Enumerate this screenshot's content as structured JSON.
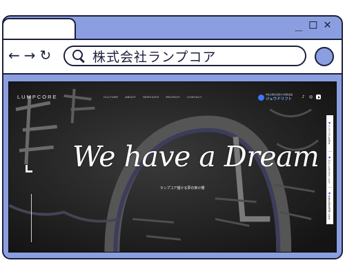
{
  "browser": {
    "window_controls": [
      "_",
      "□",
      "✕"
    ],
    "nav": {
      "back": "←",
      "forward": "→",
      "reload": "↻"
    },
    "url_text": "株式会社ランプコア",
    "colors": {
      "frame": "#8b9fe0",
      "outline": "#1b1f3b"
    }
  },
  "site": {
    "logo": "LUMPCORE",
    "nav_items": [
      "CULTURE",
      "ABOUT",
      "SERVICES",
      "RECRUIT",
      "CONTACT"
    ],
    "promo": {
      "sub": "学生の夢を応援する特別企画",
      "main": "ジュウドリフト"
    },
    "social_icons": [
      "tiktok-icon",
      "instagram-icon",
      "youtube-icon"
    ],
    "hero": {
      "title": "We have a Dream",
      "subtitle": "ランプコア描ける夢の架け橋"
    },
    "sidebar_items": [
      "ランプコアを知る",
      "わたしたちのサービス",
      "未来を創る仲間になる"
    ]
  }
}
